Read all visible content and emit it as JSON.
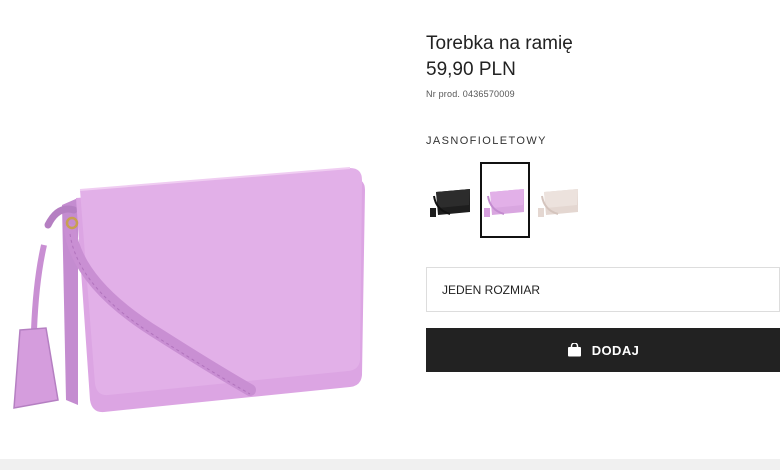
{
  "product": {
    "title": "Torebka na ramię",
    "price": "59,90 PLN",
    "sku": "Nr prod. 0436570009",
    "image_icon": "purple-shoulder-bag-image",
    "accent_color": "#d9a6e0"
  },
  "color": {
    "selected_label": "JASNOFIOLETOWY",
    "swatches": [
      {
        "icon": "black-bag-swatch",
        "color": "#1e1e1e",
        "selected": false
      },
      {
        "icon": "lilac-bag-swatch",
        "color": "#d9a6e0",
        "selected": true
      },
      {
        "icon": "beige-bag-swatch",
        "color": "#e8dcd6",
        "selected": false
      }
    ]
  },
  "size": {
    "value": "JEDEN ROZMIAR"
  },
  "add_button": {
    "label": "DODAJ",
    "icon": "shopping-bag-icon",
    "background": "#222222"
  }
}
